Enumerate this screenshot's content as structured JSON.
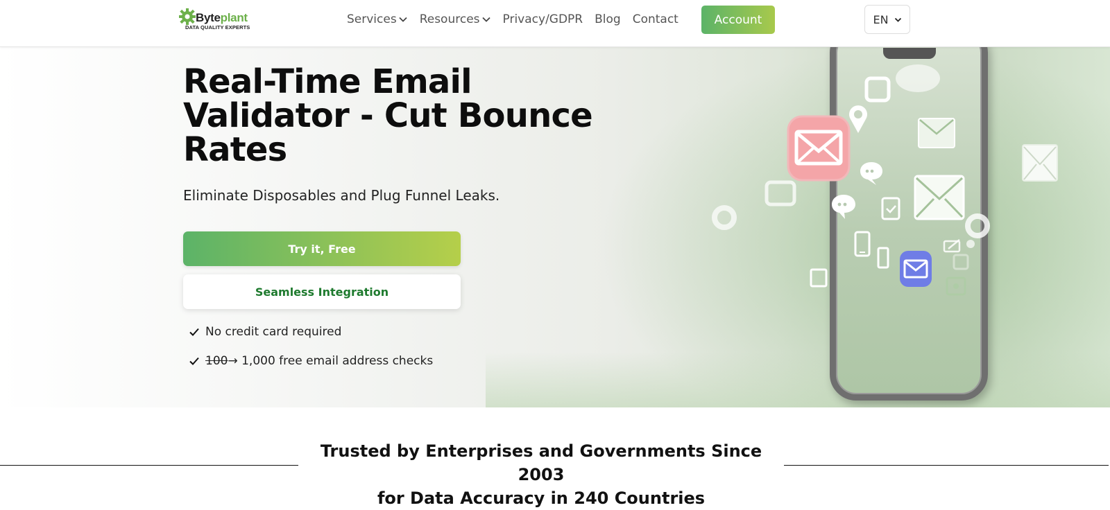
{
  "header": {
    "logo": {
      "brand_part1": "Byte",
      "brand_part2": "plant",
      "tagline": "DATA QUALITY EXPERTS"
    },
    "nav": [
      {
        "label": "Services",
        "has_dropdown": true
      },
      {
        "label": "Resources",
        "has_dropdown": true
      },
      {
        "label": "Privacy/GDPR",
        "has_dropdown": false
      },
      {
        "label": "Blog",
        "has_dropdown": false
      },
      {
        "label": "Contact",
        "has_dropdown": false
      }
    ],
    "account_label": "Account",
    "language": "EN"
  },
  "hero": {
    "title": "Real-Time Email Validator - Cut Bounce Rates",
    "subtitle": "Eliminate Disposables and Plug Funnel Leaks.",
    "primary_cta": "Try it, Free",
    "secondary_cta": "Seamless Integration",
    "checks": [
      {
        "struck": "",
        "text": "No credit card required"
      },
      {
        "struck": "100",
        "text": " → 1,000 free email address checks"
      }
    ]
  },
  "trust": {
    "line1": "Trusted by Enterprises and Governments Since 2003",
    "line2": "for Data Accuracy in 240 Countries"
  },
  "colors": {
    "brand_green": "#6cb04a",
    "gradient_start": "#5cb368",
    "gradient_end": "#b5cf4a",
    "secondary_text": "#1e7a2e"
  }
}
